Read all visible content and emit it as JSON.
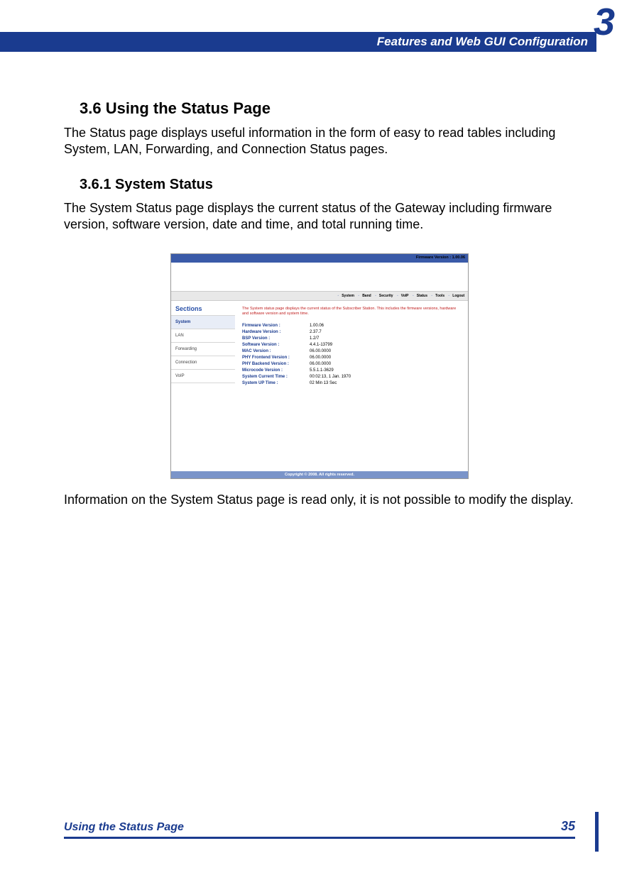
{
  "chapter_number": "3",
  "header_title": "Features and Web GUI Configuration",
  "section": {
    "heading": "3.6 Using the Status Page",
    "intro": "The Status page displays useful information in the form of easy to read tables including System, LAN, Forwarding, and Connection Status pages.",
    "subsection_heading": "3.6.1 System Status",
    "sub_intro": "The System Status page displays the current status of the Gateway including firmware version, software version, date and time, and total running time.",
    "outro": "Information on the System Status page is read only, it is not possible to modify the display."
  },
  "screenshot": {
    "firmware_label": "Firmware Version : 1.00.06",
    "menu": [
      "System",
      "Band",
      "Security",
      "VoIP",
      "Status",
      "Tools",
      "Logout"
    ],
    "sections_title": "Sections",
    "sidebar": [
      {
        "label": "System",
        "active": true
      },
      {
        "label": "LAN",
        "active": false
      },
      {
        "label": "Forwarding",
        "active": false
      },
      {
        "label": "Connection",
        "active": false
      },
      {
        "label": "VoIP",
        "active": false
      }
    ],
    "note": "The System status page displays the current status of the Subscriber Station. This includes the firmware versions, hardware and software version and system time.",
    "rows": [
      {
        "k": "Firmware Version :",
        "v": "1.00.06"
      },
      {
        "k": "Hardware Version :",
        "v": "2.37.7"
      },
      {
        "k": "BSP Version :",
        "v": "1.2/7"
      },
      {
        "k": "Software Version :",
        "v": "4.4.1-13799"
      },
      {
        "k": "MAC Version :",
        "v": "06.00.0000"
      },
      {
        "k": "PHY Frontend Version :",
        "v": "06.00.0000"
      },
      {
        "k": "PHY Backend Version :",
        "v": "06.00.0000"
      },
      {
        "k": "Microcode Version :",
        "v": "5.5.1.1-3629"
      },
      {
        "k": "System Current Time :",
        "v": "00:02:13, 1 Jan. 1970"
      },
      {
        "k": "System UP Time :",
        "v": "02 Min 13 Sec"
      }
    ],
    "copyright": "Copyright © 2008.  All rights reserved."
  },
  "footer": {
    "left": "Using the Status Page",
    "page": "35"
  }
}
